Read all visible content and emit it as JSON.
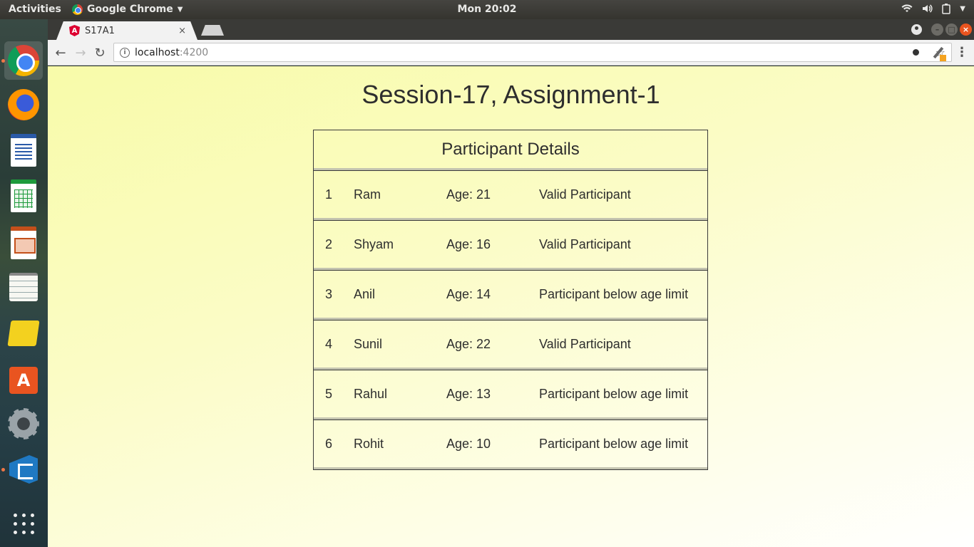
{
  "topbar": {
    "activities": "Activities",
    "app_name": "Google Chrome",
    "clock": "Mon 20:02"
  },
  "dock": {
    "items": [
      {
        "name": "Google Chrome",
        "icon": "chrome-icon",
        "running": true,
        "active": true
      },
      {
        "name": "Firefox",
        "icon": "firefox-icon",
        "running": false
      },
      {
        "name": "LibreOffice Writer",
        "icon": "writer-icon",
        "running": false
      },
      {
        "name": "LibreOffice Calc",
        "icon": "calc-icon",
        "running": false
      },
      {
        "name": "LibreOffice Impress",
        "icon": "impress-icon",
        "running": false
      },
      {
        "name": "Text Editor",
        "icon": "text-editor-icon",
        "running": false
      },
      {
        "name": "Notes",
        "icon": "notes-icon",
        "running": false
      },
      {
        "name": "Ubuntu Software",
        "icon": "software-store-icon",
        "running": false
      },
      {
        "name": "System Settings",
        "icon": "settings-icon",
        "running": false
      },
      {
        "name": "Visual Studio Code",
        "icon": "vscode-icon",
        "running": true
      },
      {
        "name": "Show Applications",
        "icon": "app-grid-icon",
        "running": false
      }
    ]
  },
  "browser": {
    "tab_title": "S17A1",
    "tab_close": "×",
    "url_host": "localhost",
    "url_port": ":4200"
  },
  "page": {
    "title": "Session-17, Assignment-1",
    "table_heading": "Participant Details",
    "participants": [
      {
        "id": "1",
        "name": "Ram",
        "age": "Age: 21",
        "status": "Valid Participant"
      },
      {
        "id": "2",
        "name": "Shyam",
        "age": "Age: 16",
        "status": "Valid Participant"
      },
      {
        "id": "3",
        "name": "Anil",
        "age": "Age: 14",
        "status": "Participant below age limit"
      },
      {
        "id": "4",
        "name": "Sunil",
        "age": "Age: 22",
        "status": "Valid Participant"
      },
      {
        "id": "5",
        "name": "Rahul",
        "age": "Age: 13",
        "status": "Participant below age limit"
      },
      {
        "id": "6",
        "name": "Rohit",
        "age": "Age: 10",
        "status": "Participant below age limit"
      }
    ]
  },
  "colors": {
    "page_bg_top": "#f8fba9",
    "text": "#2e2e2e",
    "accent_dot": "#f07746",
    "close_button": "#e9541f"
  }
}
